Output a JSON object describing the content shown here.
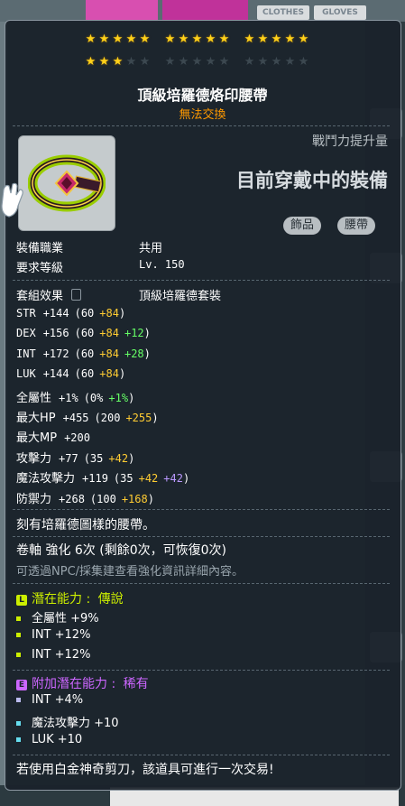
{
  "background": {
    "tabs": [
      "CLOTHES",
      "GLOVES"
    ]
  },
  "stars": {
    "filled": 18,
    "total": 30,
    "groups_per_row": [
      [
        5,
        5,
        5
      ],
      [
        5,
        5,
        5
      ]
    ]
  },
  "item": {
    "name": "頂級培羅德烙印腰帶",
    "trade_status": "無法交換",
    "power_label": "戰鬥力提升量",
    "equipped_label": "目前穿戴中的裝備",
    "tags": [
      "飾品",
      "腰帶"
    ]
  },
  "requirements": [
    {
      "label": "裝備職業",
      "value": "共用"
    },
    {
      "label": "要求等級",
      "value": "Lv. 150"
    }
  ],
  "set_effect": {
    "label": "套組效果",
    "value": "頂級培羅德套裝"
  },
  "stats": [
    {
      "name": "STR",
      "total": "+144",
      "base": "(60",
      "star": "+84",
      "extra": "",
      "close": ")"
    },
    {
      "name": "DEX",
      "total": "+156",
      "base": "(60",
      "star": "+84",
      "extra": "+12",
      "close": ")"
    },
    {
      "name": "INT",
      "total": "+172",
      "base": "(60",
      "star": "+84",
      "extra": "+28",
      "close": ")"
    },
    {
      "name": "LUK",
      "total": "+144",
      "base": "(60",
      "star": "+84",
      "extra": "",
      "close": ")"
    },
    {
      "name": "全屬性",
      "total": "+1%",
      "base": "(0%",
      "star": "",
      "extra": "+1%",
      "close": ")"
    },
    {
      "name": "最大HP",
      "total": "+455",
      "base": "(200",
      "star": "+255",
      "extra": "",
      "close": ")"
    },
    {
      "name": "最大MP",
      "total": "+200",
      "base": "",
      "star": "",
      "extra": "",
      "close": ""
    },
    {
      "name": "攻擊力",
      "total": "+77",
      "base": "(35",
      "star": "+42",
      "extra": "",
      "close": ")"
    },
    {
      "name": "魔法攻擊力",
      "total": "+119",
      "base": "(35",
      "star": "+42",
      "extra": "+42",
      "extra_color": "purple",
      "close": ")"
    },
    {
      "name": "防禦力",
      "total": "+268",
      "base": "(100",
      "star": "+168",
      "extra": "",
      "close": ")"
    }
  ],
  "description": "刻有培羅德圖樣的腰帶。",
  "upgrade": {
    "text": "卷軸 強化 6次 (剩餘0次，可恢復0次)",
    "hint": "可透過NPC/採集建查看強化資訊詳細內容。"
  },
  "potential": {
    "badge": "L",
    "label": "潛在能力",
    "grade": "傳說",
    "color": "#ccee00",
    "lines": [
      "全屬性 +9%",
      "INT +12%",
      "INT +12%"
    ]
  },
  "bonus_potential": {
    "badge": "E",
    "label": "附加潛在能力",
    "grade": "稀有",
    "color": "#cc66ff",
    "lines": [
      "INT +4%",
      "魔法攻擊力 +10",
      "LUK +10"
    ]
  },
  "footer": "若使用白金神奇剪刀，該道具可進行一次交易!"
}
